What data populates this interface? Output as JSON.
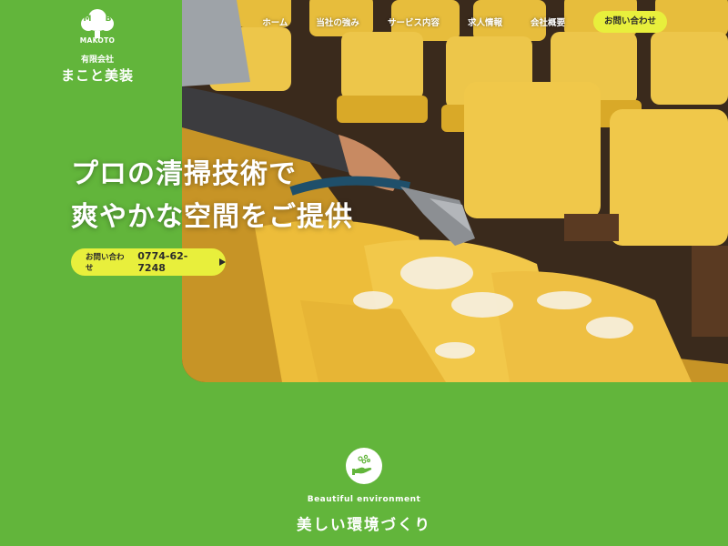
{
  "logo": {
    "mark_letters": "M B",
    "wordmark": "MAKOTO",
    "company_type": "有限会社",
    "company_name": "まこと美装"
  },
  "nav": {
    "items": [
      {
        "label": "ホーム"
      },
      {
        "label": "当社の強み"
      },
      {
        "label": "サービス内容"
      },
      {
        "label": "求人情報"
      },
      {
        "label": "会社概要"
      }
    ],
    "contact_label": "お問い合わせ"
  },
  "hero": {
    "headline_line1": "プロの清掃技術で",
    "headline_line2": "爽やかな空間をご提供",
    "cta_label": "お問い合わせ",
    "cta_phone": "0774-62-7248",
    "image": "auditorium-seat-cleaning-photo"
  },
  "section": {
    "icon": "clean-hand-icon",
    "subtitle_en": "Beautiful environment",
    "title_jp": "美しい環境づくり"
  },
  "colors": {
    "brand_green": "#62b53b",
    "accent_yellow": "#e8ef3c",
    "text_dark": "#2b2b2b"
  }
}
